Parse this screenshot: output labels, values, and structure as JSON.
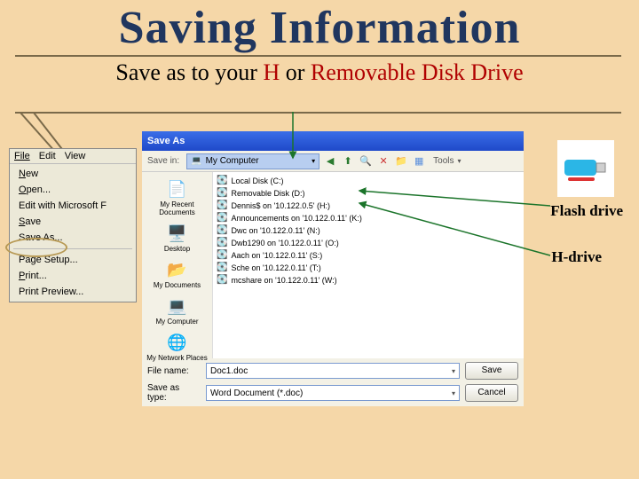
{
  "title": "Saving Information",
  "subtitle": {
    "t1": "Save as",
    "t2": " to your  ",
    "h": "H",
    "t3": "  or   ",
    "rdd": "Removable Disk Drive"
  },
  "menubar": [
    "File",
    "Edit",
    "View"
  ],
  "file_menu": {
    "items_top": [
      "New",
      "Open...",
      "Edit with Microsoft F",
      "Save",
      "Save As..."
    ],
    "items_bottom": [
      "Page Setup...",
      "Print...",
      "Print Preview..."
    ]
  },
  "dialog": {
    "title": "Save As",
    "savein_label": "Save in:",
    "savein_value": "My Computer",
    "tools_label": "Tools",
    "places": [
      {
        "label": "My Recent Documents",
        "icon": "recent"
      },
      {
        "label": "Desktop",
        "icon": "desktop"
      },
      {
        "label": "My Documents",
        "icon": "docs"
      },
      {
        "label": "My Computer",
        "icon": "computer"
      },
      {
        "label": "My Network Places",
        "icon": "network"
      }
    ],
    "files": [
      "Local Disk (C:)",
      "Removable Disk (D:)",
      "Dennis$ on '10.122.0.5' (H:)",
      "Announcements on '10.122.0.11' (K:)",
      "Dwc on '10.122.0.11' (N:)",
      "Dwb1290 on '10.122.0.11' (O:)",
      "Aach on '10.122.0.11' (S:)",
      "Sche on '10.122.0.11' (T:)",
      "mcshare on '10.122.0.11' (W:)"
    ],
    "filename_label": "File name:",
    "filename_value": "Doc1.doc",
    "saveas_label": "Save as type:",
    "saveas_value": "Word Document (*.doc)",
    "save_btn": "Save",
    "cancel_btn": "Cancel"
  },
  "annotations": {
    "flash": "Flash drive",
    "hdrive": "H-drive"
  }
}
